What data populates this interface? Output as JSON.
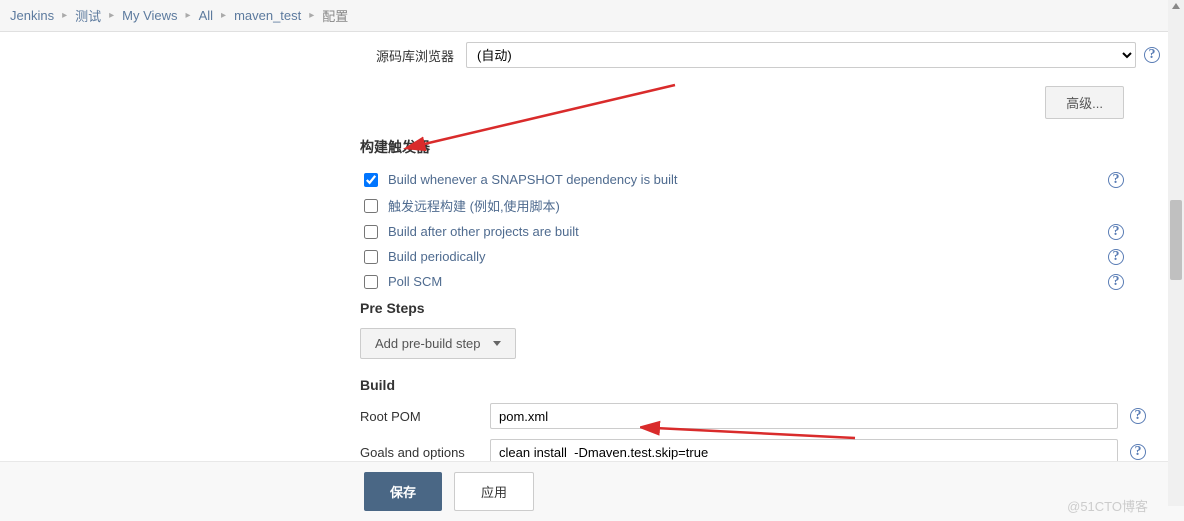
{
  "breadcrumb": {
    "items": [
      "Jenkins",
      "测试",
      "My Views",
      "All",
      "maven_test"
    ],
    "current": "配置"
  },
  "scm": {
    "browser_label": "源码库浏览器",
    "browser_value": "(自动)",
    "advanced_label": "高级..."
  },
  "triggers": {
    "title": "构建触发器",
    "items": [
      {
        "label": "Build whenever a SNAPSHOT dependency is built",
        "checked": true
      },
      {
        "label": "触发远程构建 (例如,使用脚本)",
        "checked": false
      },
      {
        "label": "Build after other projects are built",
        "checked": false
      },
      {
        "label": "Build periodically",
        "checked": false
      },
      {
        "label": "Poll SCM",
        "checked": false
      }
    ]
  },
  "pre_steps": {
    "title": "Pre Steps",
    "add_label": "Add pre-build step"
  },
  "build": {
    "title": "Build",
    "root_pom_label": "Root POM",
    "root_pom_value": "pom.xml",
    "goals_label": "Goals and options",
    "goals_value": "clean install  -Dmaven.test.skip=true"
  },
  "buttons": {
    "save": "保存",
    "apply": "应用"
  },
  "watermark": "@51CTO博客"
}
